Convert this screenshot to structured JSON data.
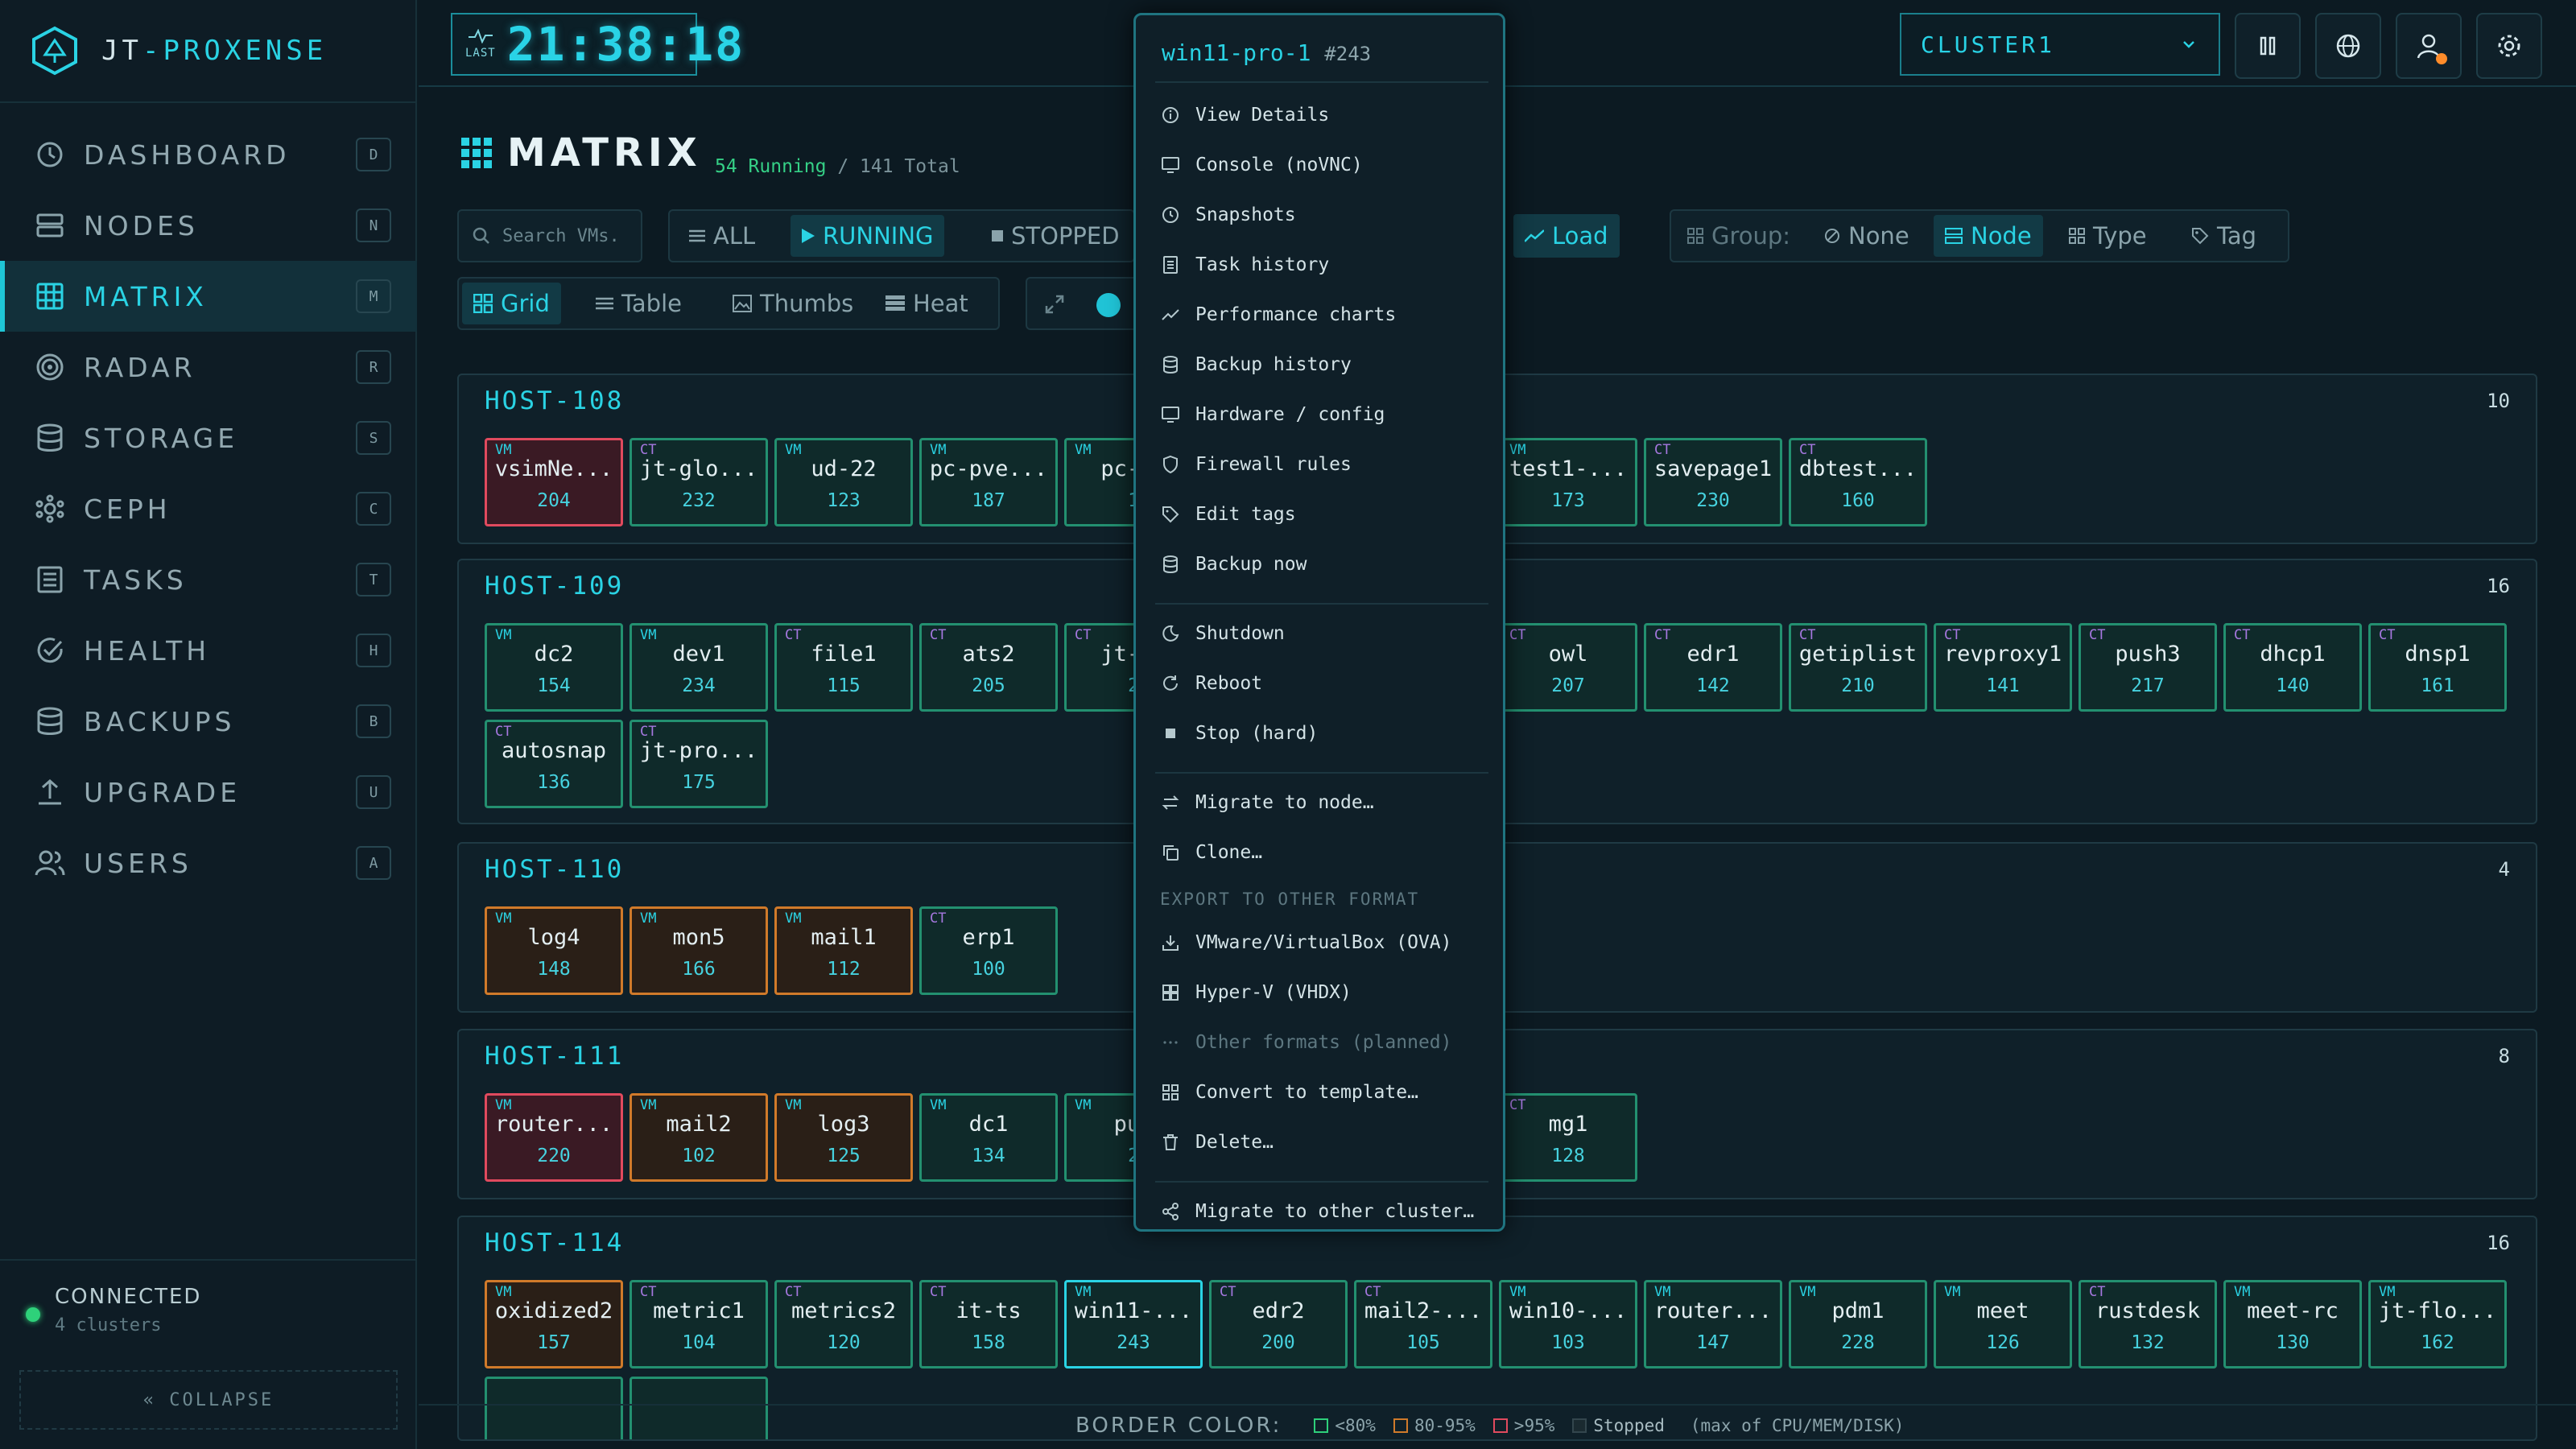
{
  "brand": {
    "part1": "JT",
    "sep": "-",
    "part2": "PROXENSE"
  },
  "clock": {
    "label": "LAST",
    "time": "21:38:18"
  },
  "nav": [
    {
      "label": "DASHBOARD",
      "key": "D",
      "icon": "clock-icon"
    },
    {
      "label": "NODES",
      "key": "N",
      "icon": "server-icon"
    },
    {
      "label": "MATRIX",
      "key": "M",
      "icon": "grid-icon",
      "active": true
    },
    {
      "label": "RADAR",
      "key": "R",
      "icon": "radar-icon"
    },
    {
      "label": "STORAGE",
      "key": "S",
      "icon": "database-icon"
    },
    {
      "label": "CEPH",
      "key": "C",
      "icon": "ceph-icon"
    },
    {
      "label": "TASKS",
      "key": "T",
      "icon": "list-icon"
    },
    {
      "label": "HEALTH",
      "key": "H",
      "icon": "check-circle-icon"
    },
    {
      "label": "BACKUPS",
      "key": "B",
      "icon": "database-icon"
    },
    {
      "label": "UPGRADE",
      "key": "U",
      "icon": "upload-icon"
    },
    {
      "label": "USERS",
      "key": "A",
      "icon": "users-icon"
    }
  ],
  "connection": {
    "status": "CONNECTED",
    "detail": "4 clusters"
  },
  "collapse_label": "« COLLAPSE",
  "cluster": {
    "selected": "CLUSTER1"
  },
  "page": {
    "title": "MATRIX",
    "running": "54 Running",
    "total": "/ 141 Total"
  },
  "search": {
    "placeholder": "Search VMs."
  },
  "filters": {
    "all": "ALL",
    "running": "RUNNING",
    "stopped": "STOPPED",
    "load": "Load"
  },
  "group": {
    "label": "Group:",
    "none": "None",
    "node": "Node",
    "type": "Type",
    "tag": "Tag"
  },
  "views": {
    "grid": "Grid",
    "table": "Table",
    "thumbs": "Thumbs",
    "heat": "Heat"
  },
  "hosts": [
    {
      "name": "HOST-108",
      "count": "10",
      "vms": [
        {
          "type": "VM",
          "name": "vsimNe...",
          "id": "204",
          "s": "red"
        },
        {
          "type": "CT",
          "name": "jt-glo...",
          "id": "232",
          "s": "green"
        },
        {
          "type": "VM",
          "name": "ud-22",
          "id": "123",
          "s": "green"
        },
        {
          "type": "VM",
          "name": "pc-pve...",
          "id": "187",
          "s": "green"
        },
        {
          "type": "VM",
          "name": "pc-pv",
          "id": "1",
          "s": "green"
        },
        {
          "type": "VM",
          "name": "test1-...",
          "id": "173",
          "s": "green",
          "c": 7
        },
        {
          "type": "CT",
          "name": "savepage1",
          "id": "230",
          "s": "green",
          "c": 8
        },
        {
          "type": "CT",
          "name": "dbtest...",
          "id": "160",
          "s": "green",
          "c": 9
        }
      ]
    },
    {
      "name": "HOST-109",
      "count": "16",
      "vms": [
        {
          "type": "VM",
          "name": "dc2",
          "id": "154",
          "s": "green"
        },
        {
          "type": "VM",
          "name": "dev1",
          "id": "234",
          "s": "green"
        },
        {
          "type": "CT",
          "name": "file1",
          "id": "115",
          "s": "green"
        },
        {
          "type": "CT",
          "name": "ats2",
          "id": "205",
          "s": "green"
        },
        {
          "type": "CT",
          "name": "jt-dc",
          "id": "2",
          "s": "green"
        },
        {
          "type": "CT",
          "name": "owl",
          "id": "207",
          "s": "green",
          "c": 7
        },
        {
          "type": "CT",
          "name": "edr1",
          "id": "142",
          "s": "green",
          "c": 8
        },
        {
          "type": "CT",
          "name": "getiplist",
          "id": "210",
          "s": "green",
          "c": 9
        },
        {
          "type": "CT",
          "name": "revproxy1",
          "id": "141",
          "s": "green",
          "c": 10
        },
        {
          "type": "CT",
          "name": "push3",
          "id": "217",
          "s": "green",
          "c": 11
        },
        {
          "type": "CT",
          "name": "dhcp1",
          "id": "140",
          "s": "green",
          "c": 12
        },
        {
          "type": "CT",
          "name": "dnsp1",
          "id": "161",
          "s": "green",
          "c": 13
        },
        {
          "type": "CT",
          "name": "autosnap",
          "id": "136",
          "s": "green",
          "r": 1,
          "c": 0
        },
        {
          "type": "CT",
          "name": "jt-pro...",
          "id": "175",
          "s": "green",
          "r": 1,
          "c": 1
        }
      ]
    },
    {
      "name": "HOST-110",
      "count": "4",
      "vms": [
        {
          "type": "VM",
          "name": "log4",
          "id": "148",
          "s": "orange"
        },
        {
          "type": "VM",
          "name": "mon5",
          "id": "166",
          "s": "orange"
        },
        {
          "type": "VM",
          "name": "mail1",
          "id": "112",
          "s": "orange"
        },
        {
          "type": "CT",
          "name": "erp1",
          "id": "100",
          "s": "green"
        }
      ]
    },
    {
      "name": "HOST-111",
      "count": "8",
      "vms": [
        {
          "type": "VM",
          "name": "router...",
          "id": "220",
          "s": "red"
        },
        {
          "type": "VM",
          "name": "mail2",
          "id": "102",
          "s": "orange"
        },
        {
          "type": "VM",
          "name": "log3",
          "id": "125",
          "s": "orange"
        },
        {
          "type": "VM",
          "name": "dc1",
          "id": "134",
          "s": "green"
        },
        {
          "type": "VM",
          "name": "pus",
          "id": "2",
          "s": "green"
        },
        {
          "type": "CT",
          "name": "mg1",
          "id": "128",
          "s": "green",
          "c": 7
        }
      ]
    },
    {
      "name": "HOST-114",
      "count": "16",
      "vms": [
        {
          "type": "VM",
          "name": "oxidized2",
          "id": "157",
          "s": "orange"
        },
        {
          "type": "CT",
          "name": "metric1",
          "id": "104",
          "s": "green"
        },
        {
          "type": "CT",
          "name": "metrics2",
          "id": "120",
          "s": "green"
        },
        {
          "type": "CT",
          "name": "it-ts",
          "id": "158",
          "s": "green"
        },
        {
          "type": "VM",
          "name": "win11-...",
          "id": "243",
          "s": "green"
        },
        {
          "type": "CT",
          "name": "edr2",
          "id": "200",
          "s": "green"
        },
        {
          "type": "CT",
          "name": "mail2-...",
          "id": "105",
          "s": "green"
        },
        {
          "type": "VM",
          "name": "win10-...",
          "id": "103",
          "s": "green"
        },
        {
          "type": "VM",
          "name": "router...",
          "id": "147",
          "s": "green"
        },
        {
          "type": "VM",
          "name": "pdm1",
          "id": "228",
          "s": "green"
        },
        {
          "type": "VM",
          "name": "meet",
          "id": "126",
          "s": "green"
        },
        {
          "type": "CT",
          "name": "rustdesk",
          "id": "132",
          "s": "green"
        },
        {
          "type": "VM",
          "name": "meet-rc",
          "id": "130",
          "s": "green"
        },
        {
          "type": "VM",
          "name": "jt-flo...",
          "id": "162",
          "s": "green"
        }
      ]
    }
  ],
  "context_menu": {
    "title": "win11-pro-1",
    "id": "#243",
    "items": [
      {
        "label": "View Details",
        "icon": "info-icon"
      },
      {
        "label": "Console (noVNC)",
        "icon": "monitor-icon"
      },
      {
        "label": "Snapshots",
        "icon": "clock-icon"
      },
      {
        "label": "Task history",
        "icon": "list-icon"
      },
      {
        "label": "Performance charts",
        "icon": "trend-icon"
      },
      {
        "label": "Backup history",
        "icon": "database-icon"
      },
      {
        "label": "Hardware / config",
        "icon": "monitor-icon"
      },
      {
        "label": "Firewall rules",
        "icon": "shield-icon"
      },
      {
        "label": "Edit tags",
        "icon": "tag-icon"
      },
      {
        "label": "Backup now",
        "icon": "database-icon"
      },
      {
        "sep": true
      },
      {
        "label": "Shutdown",
        "icon": "moon-icon"
      },
      {
        "label": "Reboot",
        "icon": "refresh-icon"
      },
      {
        "label": "Stop (hard)",
        "icon": "stop-icon"
      },
      {
        "sep": true
      },
      {
        "label": "Migrate to node…",
        "icon": "swap-icon"
      },
      {
        "label": "Clone…",
        "icon": "copy-icon"
      },
      {
        "section": "EXPORT TO OTHER FORMAT"
      },
      {
        "label": "VMware/VirtualBox (OVA)",
        "icon": "download-icon"
      },
      {
        "label": "Hyper-V (VHDX)",
        "icon": "windows-icon"
      },
      {
        "label": "Other formats (planned)",
        "icon": "dots-icon",
        "dim": true
      },
      {
        "label": "Convert to template…",
        "icon": "template-icon"
      },
      {
        "label": "Delete…",
        "icon": "trash-icon"
      },
      {
        "sep": true
      },
      {
        "label": "Migrate to other cluster…",
        "icon": "share-icon"
      }
    ]
  },
  "legend": {
    "label": "BORDER COLOR:",
    "green": "<80%",
    "orange": "80-95%",
    "red": ">95%",
    "stopped": "Stopped",
    "note": "(max of CPU/MEM/DISK)"
  },
  "colors": {
    "accent": "#2ad3e4",
    "green": "#239070",
    "orange": "#d07a2a",
    "red": "#e04a5e",
    "purple": "#a678e0"
  }
}
